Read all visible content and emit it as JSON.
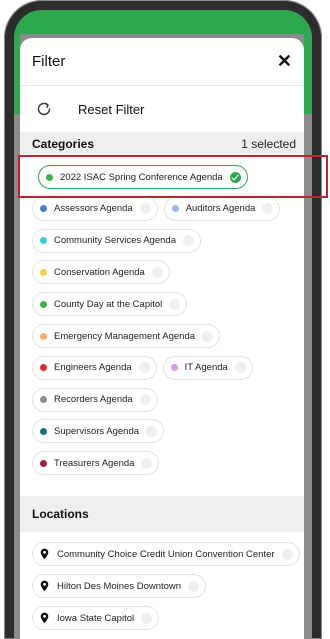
{
  "filter": {
    "title": "Filter",
    "close_icon_char": "✕",
    "reset_label": "Reset Filter"
  },
  "categories": {
    "title": "Categories",
    "selected_count": "1 selected",
    "items": [
      {
        "label": "2022 ISAC Spring Conference Agenda",
        "color": "#39b54a",
        "selected": true
      },
      {
        "label": "Assessors Agenda",
        "color": "#4a7bd8",
        "selected": false
      },
      {
        "label": "Auditors Agenda",
        "color": "#9db8ea",
        "selected": false
      },
      {
        "label": "Community Services Agenda",
        "color": "#3ec9d6",
        "selected": false
      },
      {
        "label": "Conservation Agenda",
        "color": "#f2d24a",
        "selected": false
      },
      {
        "label": "County Day at the Capitol",
        "color": "#39b54a",
        "selected": false
      },
      {
        "label": "Emergency Management Agenda",
        "color": "#f6ad6e",
        "selected": false
      },
      {
        "label": "Engineers Agenda",
        "color": "#e02b2b",
        "selected": false
      },
      {
        "label": "IT Agenda",
        "color": "#d49bf2",
        "selected": false
      },
      {
        "label": "Recorders Agenda",
        "color": "#8c8c8c",
        "selected": false
      },
      {
        "label": "Supervisors Agenda",
        "color": "#1d6e7c",
        "selected": false
      },
      {
        "label": "Treasurers Agenda",
        "color": "#9e1f2f",
        "selected": false
      }
    ]
  },
  "locations": {
    "title": "Locations",
    "items": [
      {
        "label": "Community Choice Credit Union Convention Center"
      },
      {
        "label": "Hilton Des Moines Downtown"
      },
      {
        "label": "Iowa State Capitol"
      }
    ]
  },
  "colors": {
    "accent_green": "#2ea84f",
    "highlight_red": "#c8202a"
  }
}
